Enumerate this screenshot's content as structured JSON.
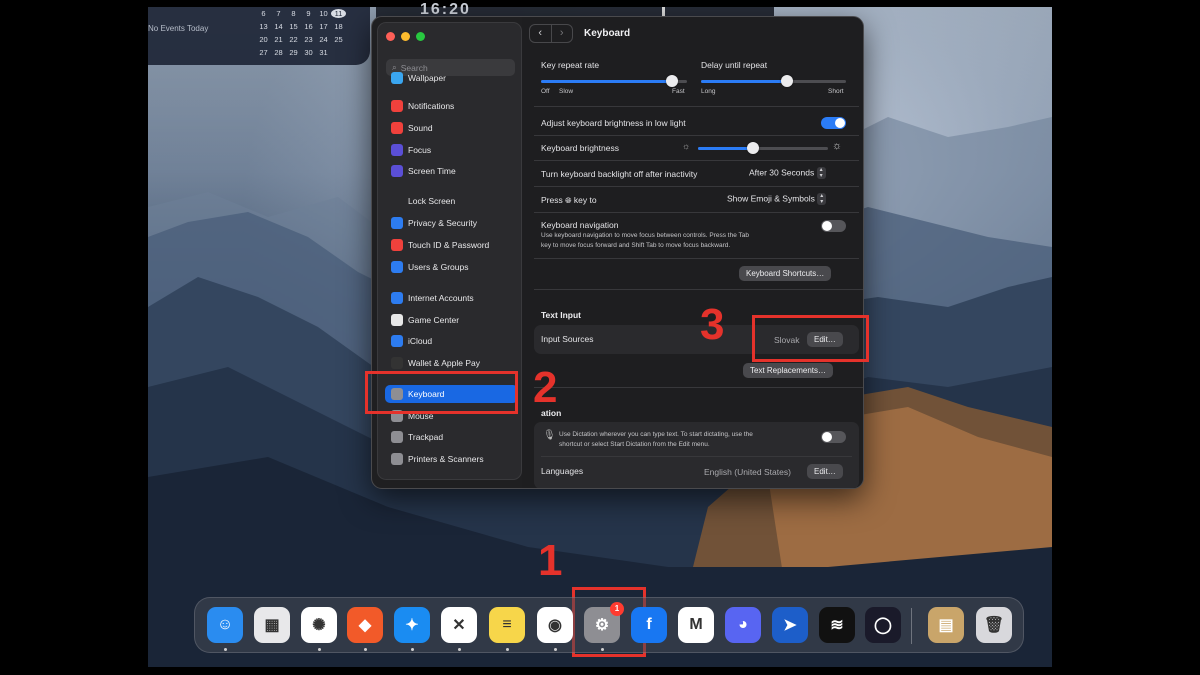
{
  "calendar": {
    "no_events": "No Events Today",
    "rows": [
      [
        "6",
        "7",
        "8",
        "9",
        "10",
        "11"
      ],
      [
        "13",
        "14",
        "15",
        "16",
        "17",
        "18"
      ],
      [
        "20",
        "21",
        "22",
        "23",
        "24",
        "25"
      ],
      [
        "27",
        "28",
        "29",
        "30",
        "31"
      ]
    ],
    "today": "11"
  },
  "clock_fragment": "16:20",
  "window": {
    "title": "Keyboard",
    "search_placeholder": "Search",
    "sidebar": [
      {
        "label": "Wallpaper",
        "icon": "wallpaper-icon",
        "color": "#3aa6f0"
      },
      {
        "label": "Notifications",
        "icon": "bell-icon",
        "color": "#f0413c"
      },
      {
        "label": "Sound",
        "icon": "speaker-icon",
        "color": "#f0413c"
      },
      {
        "label": "Focus",
        "icon": "moon-icon",
        "color": "#5b4fd6"
      },
      {
        "label": "Screen Time",
        "icon": "hourglass-icon",
        "color": "#5b4fd6"
      },
      {
        "label": "Lock Screen",
        "icon": "lock-icon",
        "color": "#2a2a2d"
      },
      {
        "label": "Privacy & Security",
        "icon": "hand-icon",
        "color": "#2d7cf0"
      },
      {
        "label": "Touch ID & Password",
        "icon": "fingerprint-icon",
        "color": "#f0413c"
      },
      {
        "label": "Users & Groups",
        "icon": "users-icon",
        "color": "#2d7cf0"
      },
      {
        "label": "Internet Accounts",
        "icon": "at-icon",
        "color": "#2d7cf0"
      },
      {
        "label": "Game Center",
        "icon": "gamecenter-icon",
        "color": "#e8e8e8"
      },
      {
        "label": "iCloud",
        "icon": "cloud-icon",
        "color": "#2d7cf0"
      },
      {
        "label": "Wallet & Apple Pay",
        "icon": "wallet-icon",
        "color": "#333333"
      },
      {
        "label": "Keyboard",
        "icon": "keyboard-icon",
        "color": "#8e8e93"
      },
      {
        "label": "Mouse",
        "icon": "mouse-icon",
        "color": "#8e8e93"
      },
      {
        "label": "Trackpad",
        "icon": "trackpad-icon",
        "color": "#8e8e93"
      },
      {
        "label": "Printers & Scanners",
        "icon": "printer-icon",
        "color": "#8e8e93"
      }
    ],
    "active_item": "Keyboard"
  },
  "keyboard": {
    "key_repeat": {
      "label": "Key repeat rate",
      "off": "Off",
      "slow": "Slow",
      "fast": "Fast",
      "value": 0.9
    },
    "delay_repeat": {
      "label": "Delay until repeat",
      "long": "Long",
      "short": "Short",
      "value": 0.59
    },
    "adjust_brightness": {
      "label": "Adjust keyboard brightness in low light",
      "on": true
    },
    "brightness": {
      "label": "Keyboard brightness",
      "value": 0.42
    },
    "backlight_off": {
      "label": "Turn keyboard backlight off after inactivity",
      "value": "After 30 Seconds"
    },
    "press_key": {
      "prefix": "Press",
      "suffix": "key to",
      "value": "Show Emoji & Symbols"
    },
    "navigation": {
      "label": "Keyboard navigation",
      "desc1": "Use keyboard navigation to move focus between controls. Press the Tab",
      "desc2": "key to move focus forward and Shift Tab to move focus backward.",
      "on": false
    },
    "shortcuts_button": "Keyboard Shortcuts…",
    "text_input_header": "Text Input",
    "input_sources": {
      "label": "Input Sources",
      "value": "Slovak",
      "edit": "Edit…"
    },
    "text_replacements_button": "Text Replacements…",
    "dictation_header": "ation",
    "dictation": {
      "desc1": "Use Dictation wherever you can type text. To start dictating, use the",
      "desc2": "shortcut or select Start Dictation from the Edit menu.",
      "on": false
    },
    "languages": {
      "label": "Languages",
      "value": "English (United States)",
      "edit": "Edit…"
    }
  },
  "annotations": [
    "1",
    "2",
    "3"
  ],
  "dock": [
    {
      "name": "finder",
      "color": "#2a8cf0",
      "glyph": "☺"
    },
    {
      "name": "launchpad",
      "color": "#e8e8ea",
      "glyph": "▦"
    },
    {
      "name": "chatgpt",
      "color": "#ffffff",
      "glyph": "✺"
    },
    {
      "name": "brave",
      "color": "#f25a29",
      "glyph": "◆"
    },
    {
      "name": "safari",
      "color": "#1a8cf2",
      "glyph": "✦"
    },
    {
      "name": "capcut",
      "color": "#ffffff",
      "glyph": "✕"
    },
    {
      "name": "notes",
      "color": "#f7d64a",
      "glyph": "≡"
    },
    {
      "name": "chrome",
      "color": "#ffffff",
      "glyph": "◉"
    },
    {
      "name": "system-settings",
      "color": "#8e8e93",
      "glyph": "⚙",
      "badge": "1"
    },
    {
      "name": "facebook",
      "color": "#1877f2",
      "glyph": "f"
    },
    {
      "name": "gmail",
      "color": "#ffffff",
      "glyph": "M"
    },
    {
      "name": "discord",
      "color": "#5865f2",
      "glyph": "◕"
    },
    {
      "name": "telegram-like",
      "color": "#1d5ec9",
      "glyph": "➤"
    },
    {
      "name": "spotify",
      "color": "#111111",
      "glyph": "≋"
    },
    {
      "name": "circle-app",
      "color": "#1a1a2a",
      "glyph": "◯"
    },
    {
      "name": "archive",
      "color": "#c9a56a",
      "glyph": "▤"
    },
    {
      "name": "trash",
      "color": "#d8d8dc",
      "glyph": "🗑"
    }
  ]
}
